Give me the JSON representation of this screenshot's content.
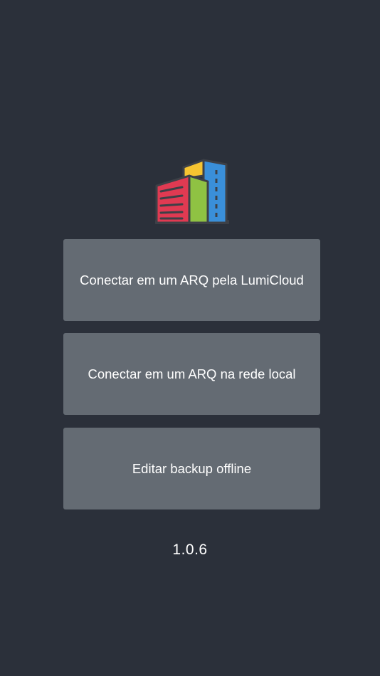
{
  "logo": {
    "icon": "building-logo-icon",
    "colors": {
      "red": "#e03a52",
      "green": "#8fc243",
      "blue": "#3a8fd9",
      "yellow": "#f6c431",
      "outline": "#3d4047"
    }
  },
  "menu": {
    "cloud_label": "Conectar em um ARQ pela LumiCloud",
    "local_label": "Conectar em um ARQ na rede local",
    "offline_label": "Editar backup offline"
  },
  "version": "1.0.6",
  "colors": {
    "background": "#2b303a",
    "button": "#646b73",
    "text": "#ffffff"
  }
}
